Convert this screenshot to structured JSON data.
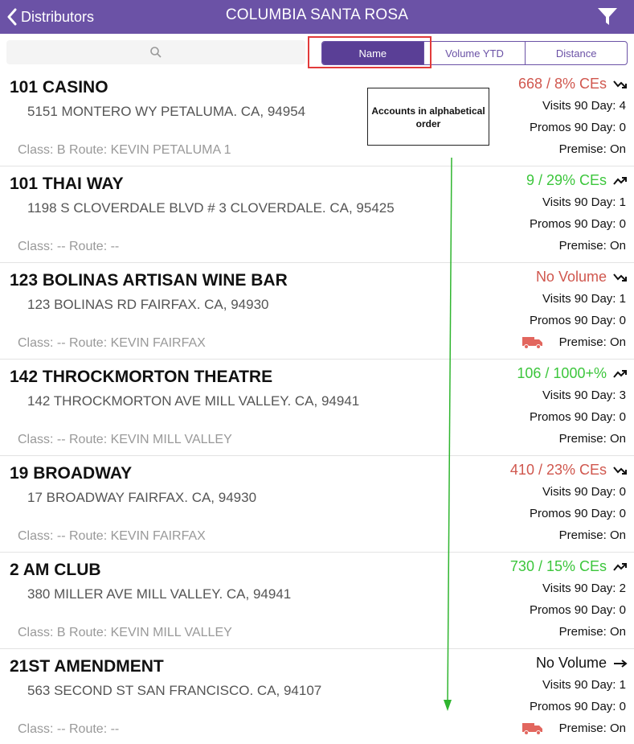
{
  "nav": {
    "back_label": "Distributors",
    "title": "COLUMBIA SANTA ROSA"
  },
  "search": {
    "placeholder": ""
  },
  "sort": {
    "options": [
      "Name",
      "Volume YTD",
      "Distance"
    ],
    "selected": "Name"
  },
  "annotation": {
    "callout_text": "Accounts in alphabetical order"
  },
  "colors": {
    "accent": "#6b52a6",
    "negative": "#d0574e",
    "positive": "#3cc63c",
    "highlight": "#e23b3b",
    "arrow": "#2fb52f"
  },
  "accounts": [
    {
      "name": "101 CASINO",
      "address": "5151 MONTERO WY PETALUMA. CA, 94954",
      "class_route": "Class: B  Route: KEVIN PETALUMA 1",
      "volume": "668 / 8% CEs",
      "volume_color": "red",
      "trend": "down-trend-icon",
      "visits": "Visits 90 Day: 4",
      "promos": "Promos 90 Day: 0",
      "premise": "Premise: On",
      "truck": false
    },
    {
      "name": "101 THAI WAY",
      "address": "1198 S CLOVERDALE BLVD # 3 CLOVERDALE. CA, 95425",
      "class_route": "Class: --  Route: --",
      "volume": "9 / 29% CEs",
      "volume_color": "green",
      "trend": "up-trend-icon",
      "visits": "Visits 90 Day: 1",
      "promos": "Promos 90 Day: 0",
      "premise": "Premise: On",
      "truck": false
    },
    {
      "name": "123 BOLINAS ARTISAN WINE BAR",
      "address": "123 BOLINAS RD FAIRFAX. CA, 94930",
      "class_route": "Class: --  Route: KEVIN FAIRFAX",
      "volume": "No Volume",
      "volume_color": "red",
      "trend": "down-trend-icon",
      "visits": "Visits 90 Day: 1",
      "promos": "Promos 90 Day: 0",
      "premise": "Premise: On",
      "truck": true
    },
    {
      "name": "142 THROCKMORTON THEATRE",
      "address": "142 THROCKMORTON AVE MILL VALLEY. CA, 94941",
      "class_route": "Class: --  Route: KEVIN MILL VALLEY",
      "volume": "106 / 1000+%",
      "volume_color": "green",
      "trend": "up-trend-icon",
      "visits": "Visits 90 Day: 3",
      "promos": "Promos 90 Day: 0",
      "premise": "Premise: On",
      "truck": false
    },
    {
      "name": "19 BROADWAY",
      "address": "17 BROADWAY FAIRFAX. CA, 94930",
      "class_route": "Class: --  Route: KEVIN FAIRFAX",
      "volume": "410 / 23% CEs",
      "volume_color": "red",
      "trend": "down-trend-icon",
      "visits": "Visits 90 Day: 0",
      "promos": "Promos 90 Day: 0",
      "premise": "Premise: On",
      "truck": false
    },
    {
      "name": "2 AM CLUB",
      "address": "380 MILLER AVE MILL VALLEY. CA, 94941",
      "class_route": "Class: B  Route: KEVIN MILL VALLEY",
      "volume": "730 / 15% CEs",
      "volume_color": "green",
      "trend": "up-trend-icon",
      "visits": "Visits 90 Day: 2",
      "promos": "Promos 90 Day: 0",
      "premise": "Premise: On",
      "truck": false
    },
    {
      "name": "21ST AMENDMENT",
      "address": "563 SECOND ST SAN FRANCISCO. CA, 94107",
      "class_route": "Class: --  Route: --",
      "volume": "No Volume",
      "volume_color": "black",
      "trend": "flat-trend-icon",
      "visits": "Visits 90 Day: 1",
      "promos": "Promos 90 Day: 0",
      "premise": "Premise: On",
      "truck": true
    }
  ]
}
